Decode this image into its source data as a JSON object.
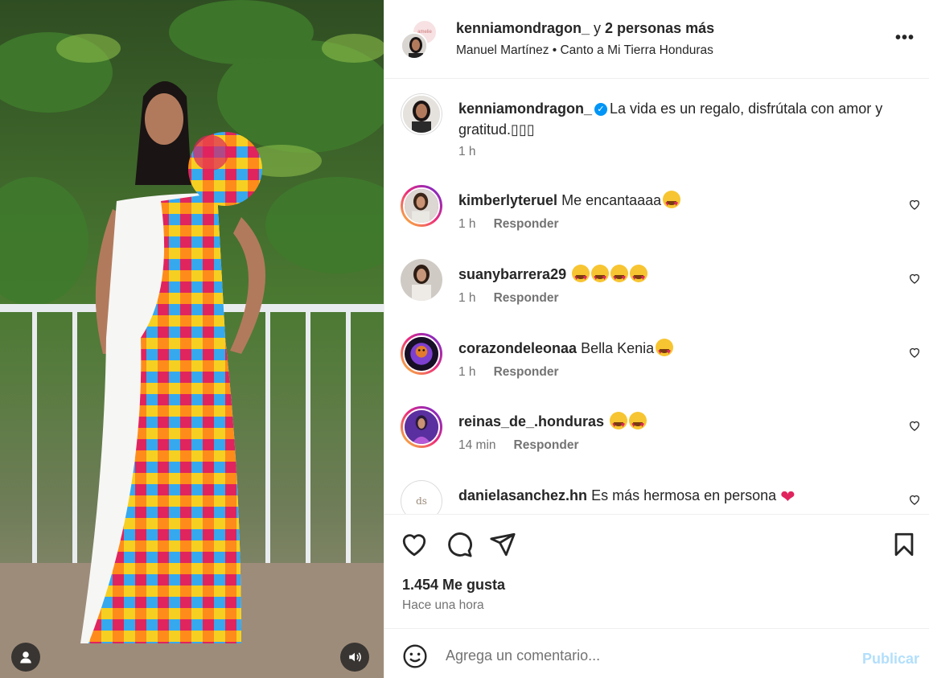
{
  "header": {
    "username": "kenniamondragon_",
    "joiner": " y ",
    "others": "2 personas más",
    "audio": "Manuel Martínez • Canto a Mi Tierra Honduras",
    "second_avatar_text": "amelie",
    "more_icon": "more-icon"
  },
  "caption": {
    "username": "kenniamondragon_",
    "verified_icon": "verified-badge-icon",
    "text": "La vida es un regalo, disfrútala con amor y gratitud.▯▯▯",
    "time": "1 h"
  },
  "comments": [
    {
      "username": "kimberlyteruel",
      "text": "Me encantaaaa",
      "emojis": 1,
      "time": "1 h",
      "reply": "Responder"
    },
    {
      "username": "suanybarrera29",
      "text": "",
      "emojis": 4,
      "time": "1 h",
      "reply": "Responder"
    },
    {
      "username": "corazondeleonaa",
      "text": "Bella Kenia",
      "emojis": 1,
      "time": "1 h",
      "reply": "Responder"
    },
    {
      "username": "reinas_de_.honduras",
      "text": "",
      "emojis": 2,
      "time": "14 min",
      "reply": "Responder"
    },
    {
      "username": "danielasanchez.hn",
      "text": "Es más hermosa en persona",
      "heart": "❤",
      "avatar_text": "ds"
    }
  ],
  "footer": {
    "likes": "1.454 Me gusta",
    "posted": "Hace una hora",
    "placeholder": "Agrega un comentario...",
    "publish": "Publicar"
  },
  "colors": {
    "accent": "#0095f6",
    "publish_disabled": "#b2dffc",
    "muted": "#737373"
  }
}
